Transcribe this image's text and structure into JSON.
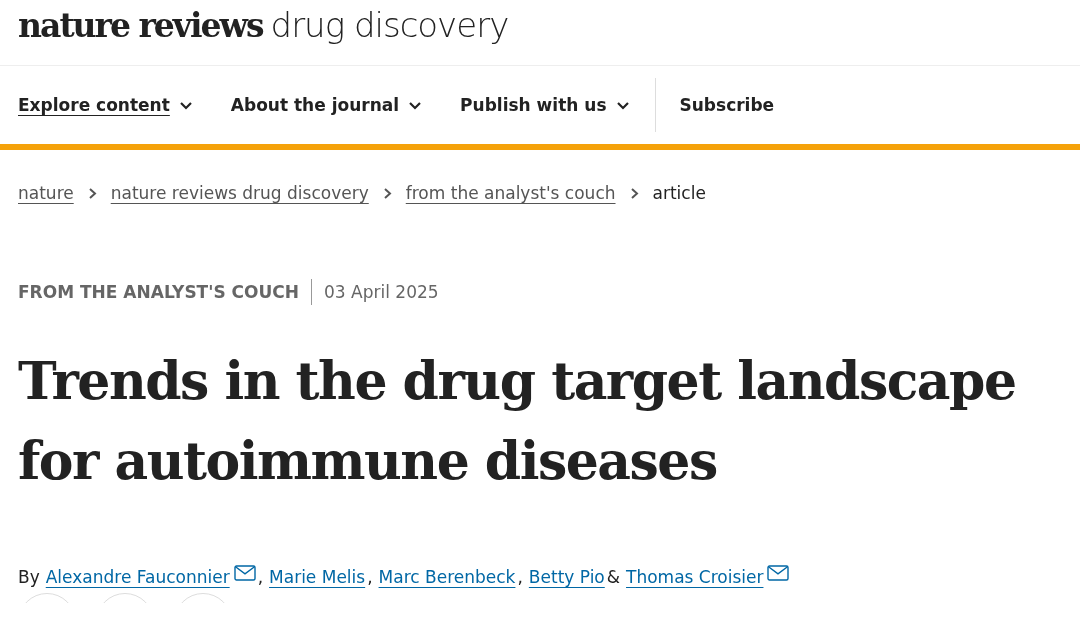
{
  "logo": {
    "brand": "nature reviews",
    "journal": "drug discovery"
  },
  "nav": [
    {
      "label": "Explore content",
      "dropdown": true,
      "selected": true
    },
    {
      "label": "About the journal",
      "dropdown": true,
      "selected": false
    },
    {
      "label": "Publish with us",
      "dropdown": true,
      "selected": false
    },
    {
      "label": "Subscribe",
      "dropdown": false,
      "selected": false
    }
  ],
  "breadcrumbs": [
    {
      "label": "nature",
      "link": true
    },
    {
      "label": "nature reviews drug discovery",
      "link": true
    },
    {
      "label": "from the analyst's couch",
      "link": true
    },
    {
      "label": "article",
      "link": false
    }
  ],
  "article": {
    "type": "FROM THE ANALYST'S COUCH",
    "date": "03 April 2025",
    "title": "Trends in the drug target landscape for autoimmune diseases",
    "by": "By",
    "authors": [
      {
        "name": "Alexandre Fauconnier",
        "email": true,
        "separator": ","
      },
      {
        "name": "Marie Melis",
        "email": false,
        "separator": ","
      },
      {
        "name": "Marc Berenbeck",
        "email": false,
        "separator": ","
      },
      {
        "name": "Betty Pio",
        "email": false,
        "separator": "&"
      },
      {
        "name": "Thomas Croisier",
        "email": true
      }
    ]
  }
}
